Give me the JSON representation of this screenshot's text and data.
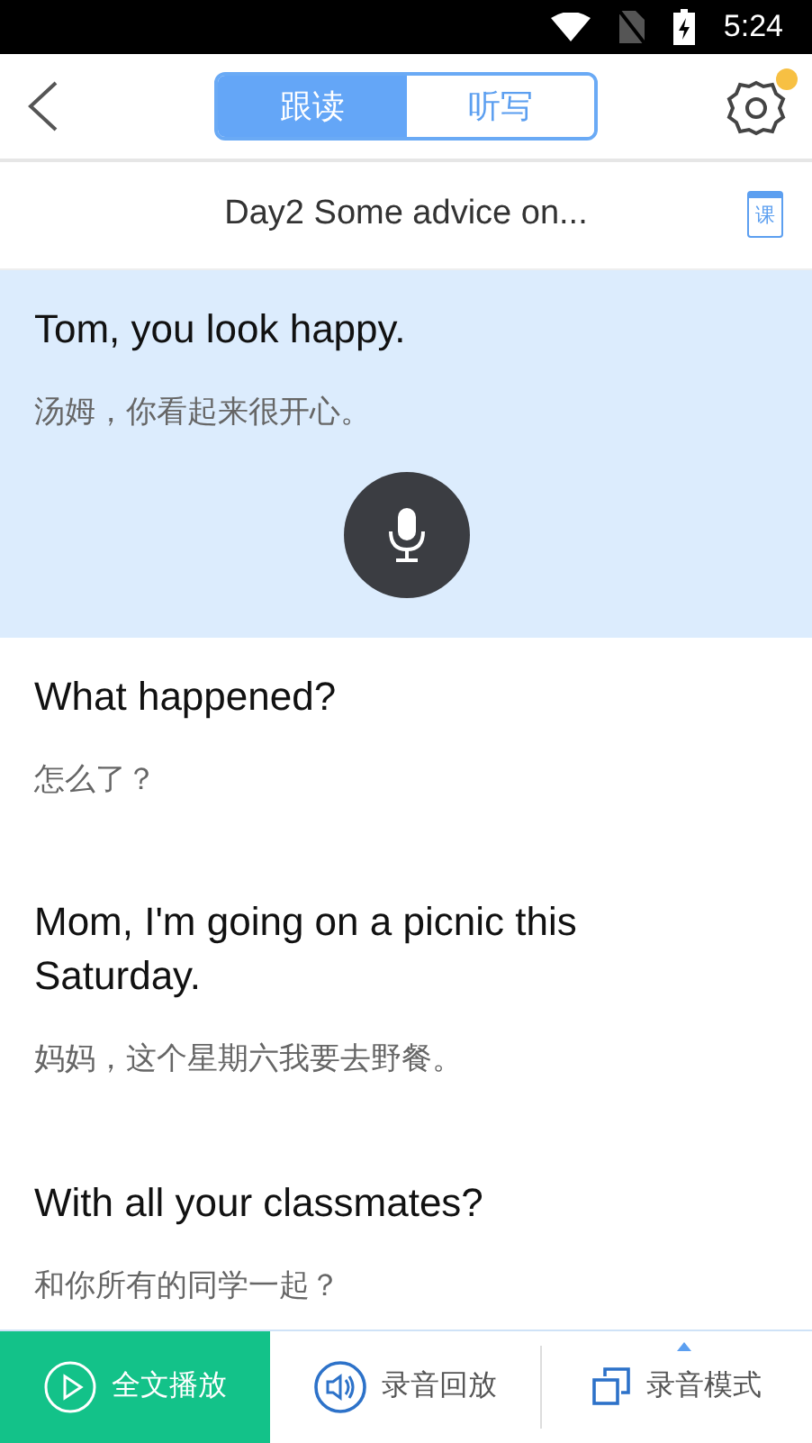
{
  "status_bar": {
    "time": "5:24"
  },
  "header": {
    "tabs": [
      {
        "label": "跟读",
        "selected": true
      },
      {
        "label": "听写",
        "selected": false
      }
    ],
    "settings_badge": true
  },
  "lesson": {
    "title": "Day2 Some advice on...",
    "book_label": "课"
  },
  "sentences": [
    {
      "english": "Tom, you look happy.",
      "chinese": "汤姆，你看起来很开心。",
      "selected": true
    },
    {
      "english": "What happened?",
      "chinese": "怎么了？",
      "selected": false
    },
    {
      "english": "Mom, I'm going on a picnic this Saturday.",
      "chinese": "妈妈，这个星期六我要去野餐。",
      "selected": false
    },
    {
      "english": "With all your classmates?",
      "chinese": "和你所有的同学一起？",
      "selected": false
    }
  ],
  "bottom_bar": [
    {
      "kind": "play",
      "label": "全文播放",
      "selected": true
    },
    {
      "kind": "playback",
      "label": "录音回放",
      "selected": false
    },
    {
      "kind": "mode",
      "label": "录音模式",
      "selected": false
    }
  ]
}
